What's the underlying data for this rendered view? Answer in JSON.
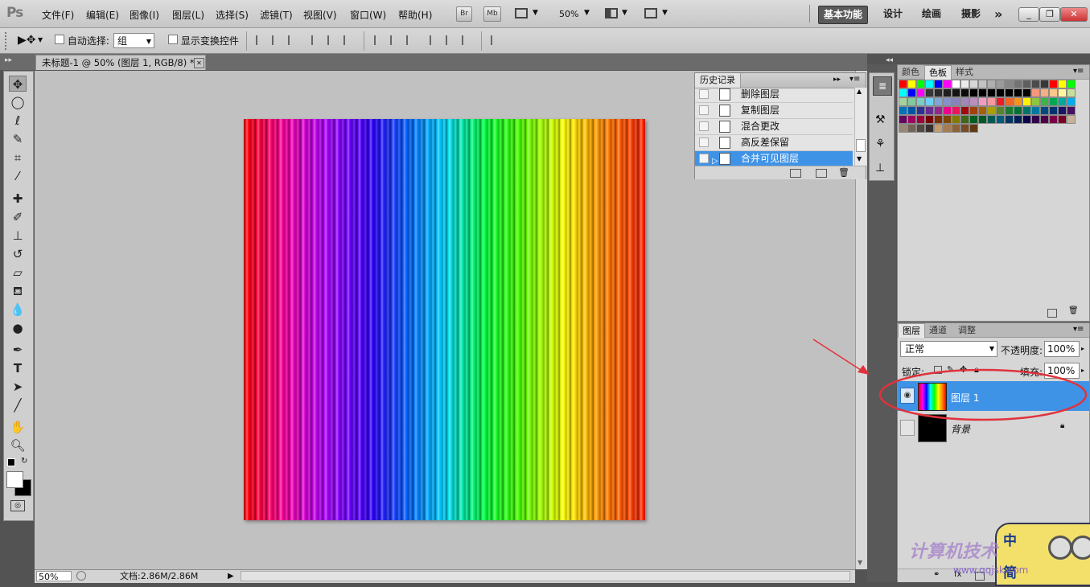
{
  "app": {
    "logo": "Ps"
  },
  "menu": [
    "文件(F)",
    "编辑(E)",
    "图像(I)",
    "图层(L)",
    "选择(S)",
    "滤镜(T)",
    "视图(V)",
    "窗口(W)",
    "帮助(H)"
  ],
  "menubar_tools": {
    "bridge": "Br",
    "mini_bridge": "Mb",
    "zoom": "50%"
  },
  "workspaces": {
    "active": "基本功能",
    "items": [
      "设计",
      "绘画",
      "摄影"
    ],
    "more": "»"
  },
  "options_bar": {
    "auto_select_label": "自动选择:",
    "auto_select_value": "组",
    "transform_label": "显示变换控件"
  },
  "document_tab": {
    "title": "未标题-1 @ 50% (图层 1, RGB/8) *",
    "close": "✕"
  },
  "status": {
    "zoom": "50%",
    "doc_info": "文档:2.86M/2.86M"
  },
  "history": {
    "title": "历史记录",
    "items": [
      {
        "label": "删除图层",
        "selected": false
      },
      {
        "label": "复制图层",
        "selected": false
      },
      {
        "label": "混合更改",
        "selected": false
      },
      {
        "label": "高反差保留",
        "selected": false
      },
      {
        "label": "合并可见图层",
        "selected": true
      }
    ]
  },
  "swatches_panel": {
    "tabs": [
      "颜色",
      "色板",
      "样式"
    ],
    "active_tab": "色板",
    "colors": [
      "#ff0000",
      "#ffff00",
      "#00ff00",
      "#00ffff",
      "#0000ff",
      "#ff00ff",
      "#ffffff",
      "#ebebeb",
      "#d7d7d7",
      "#c3c3c3",
      "#afafaf",
      "#9b9b9b",
      "#878787",
      "#737373",
      "#5f5f5f",
      "#4b4b4b",
      "#373737",
      "#ff0000",
      "#ffff00",
      "#00ff00",
      "#00ffff",
      "#0000ff",
      "#ff00ff",
      "#373737",
      "#2b2b2b",
      "#1f1f1f",
      "#141414",
      "#0a0a0a",
      "#000000",
      "#000000",
      "#000000",
      "#000000",
      "#000000",
      "#000000",
      "#000000",
      "#f7977a",
      "#f9ad81",
      "#fdc68a",
      "#fff79a",
      "#c4df9b",
      "#a3d39c",
      "#82ca9d",
      "#7bcdc8",
      "#6ecff6",
      "#7ea7d8",
      "#8493ca",
      "#8882be",
      "#a187be",
      "#bc8dbf",
      "#f49ac2",
      "#f6989d",
      "#ed1c24",
      "#f26522",
      "#f7941d",
      "#fff200",
      "#8dc63f",
      "#39b54a",
      "#00a651",
      "#00a99d",
      "#00aeef",
      "#0072bc",
      "#0054a6",
      "#2e3192",
      "#662d91",
      "#92278f",
      "#ec008c",
      "#ed145b",
      "#9e0b0f",
      "#a0410d",
      "#a36209",
      "#aba000",
      "#598527",
      "#197b30",
      "#007236",
      "#00746b",
      "#0076a3",
      "#004a80",
      "#003471",
      "#1b1464",
      "#440e62",
      "#630460",
      "#9e005d",
      "#9e0039",
      "#790000",
      "#7b2e00",
      "#7d4900",
      "#827b00",
      "#406618",
      "#005e20",
      "#005826",
      "#005952",
      "#005b7f",
      "#003663",
      "#002157",
      "#0d004c",
      "#32004b",
      "#4b0049",
      "#7b0046",
      "#7a0026",
      "#c7b299",
      "#998675",
      "#736357",
      "#534741",
      "#37302d",
      "#c69c6d",
      "#a67c52",
      "#8c6239",
      "#754c24",
      "#603913"
    ]
  },
  "layers_panel": {
    "tabs": [
      "图层",
      "通道",
      "调整"
    ],
    "active_tab": "图层",
    "blend_mode": "正常",
    "opacity_label": "不透明度:",
    "opacity": "100%",
    "lock_label": "锁定:",
    "fill_label": "填充:",
    "fill": "100%",
    "layers": [
      {
        "name": "图层 1",
        "selected": true,
        "visible": true
      },
      {
        "name": "背景",
        "selected": false,
        "visible": false,
        "locked": true
      }
    ]
  },
  "watermark": {
    "line1": "中",
    "line2": "简",
    "site": "计算机技术",
    "url": "www.qqjsk.com"
  }
}
